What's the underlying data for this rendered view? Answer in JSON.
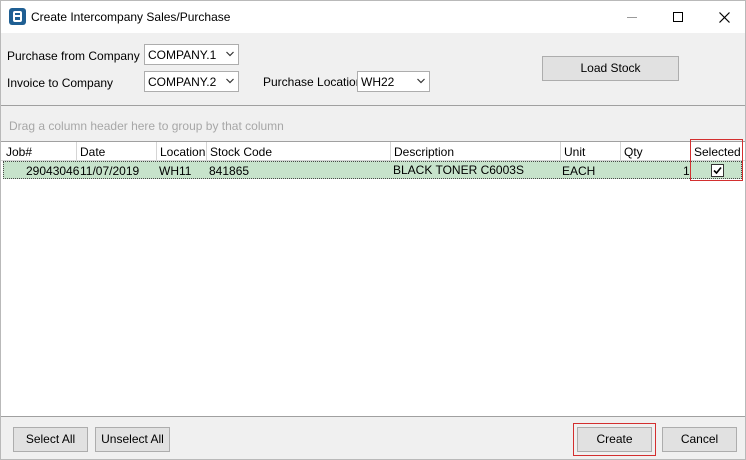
{
  "window": {
    "title": "Create Intercompany Sales/Purchase",
    "icon": "app-icon"
  },
  "form": {
    "purchase_from_label": "Purchase from Company",
    "purchase_from_value": "COMPANY.1",
    "invoice_to_label": "Invoice to Company",
    "invoice_to_value": "COMPANY.2",
    "purchase_location_label": "Purchase Location",
    "purchase_location_value": "WH22",
    "load_stock_label": "Load Stock"
  },
  "grid": {
    "group_hint": "Drag a column header here to group by that column",
    "columns": [
      "Job#",
      "Date",
      "Location",
      "Stock Code",
      "Description",
      "Unit",
      "Qty",
      "Selected"
    ],
    "rows": [
      {
        "job": "29043046",
        "date": "11/07/2019",
        "location": "WH11",
        "stock_code": "841865",
        "description": "BLACK TONER C6003S",
        "unit": "EACH",
        "qty": "1",
        "selected": true
      }
    ],
    "row_highlight_color": "#c7e3cb"
  },
  "footer": {
    "select_all_label": "Select All",
    "unselect_all_label": "Unselect All",
    "create_label": "Create",
    "cancel_label": "Cancel"
  },
  "colors": {
    "annotation_red": "#d32f2f",
    "app_icon_blue": "#1f5f93"
  }
}
